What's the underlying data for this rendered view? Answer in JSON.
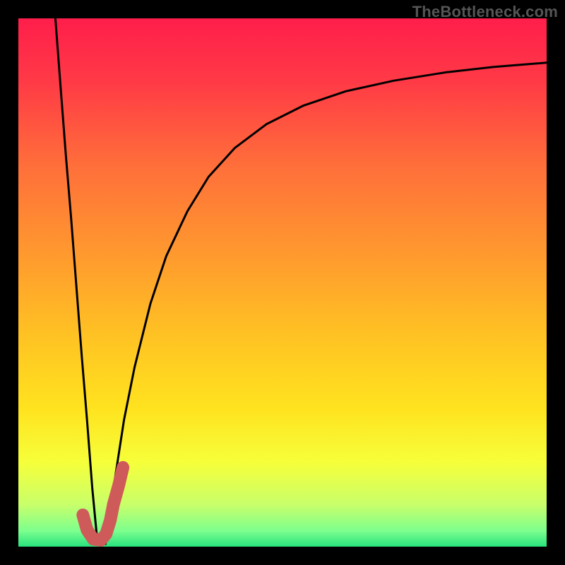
{
  "watermark": "TheBottleneck.com",
  "colors": {
    "page_bg": "#000000",
    "curve": "#000000",
    "marker": "#cf5a5a",
    "gradient_stops": [
      {
        "offset": 0.0,
        "color": "#ff1e4b"
      },
      {
        "offset": 0.12,
        "color": "#ff3a46"
      },
      {
        "offset": 0.28,
        "color": "#ff6f3a"
      },
      {
        "offset": 0.45,
        "color": "#ff9a2e"
      },
      {
        "offset": 0.6,
        "color": "#ffc223"
      },
      {
        "offset": 0.74,
        "color": "#ffe31f"
      },
      {
        "offset": 0.84,
        "color": "#f6ff3a"
      },
      {
        "offset": 0.92,
        "color": "#c9ff6a"
      },
      {
        "offset": 0.97,
        "color": "#7dff8e"
      },
      {
        "offset": 1.0,
        "color": "#28e27e"
      }
    ]
  },
  "chart_data": {
    "type": "line",
    "title": "",
    "xlabel": "",
    "ylabel": "",
    "xlim": [
      0,
      100
    ],
    "ylim": [
      0,
      100
    ],
    "grid": false,
    "series": [
      {
        "name": "left-branch",
        "x": [
          7,
          8,
          9,
          10,
          11,
          12,
          13,
          14,
          15
        ],
        "values": [
          100,
          87,
          74,
          62,
          49,
          36,
          24,
          11,
          0.5
        ]
      },
      {
        "name": "right-branch",
        "x": [
          16.5,
          18,
          20,
          22,
          25,
          28,
          32,
          36,
          41,
          47,
          54,
          62,
          71,
          81,
          90,
          100
        ],
        "values": [
          0.5,
          11,
          24,
          34,
          46,
          55,
          63.5,
          70,
          75.5,
          80,
          83.5,
          86.2,
          88.2,
          89.8,
          90.8,
          91.6
        ]
      }
    ],
    "annotations": [
      {
        "name": "valley-J-marker",
        "kind": "highlight-stroke",
        "color": "#cf5a5a",
        "points_x": [
          12.2,
          13.0,
          14.2,
          15.6,
          16.6,
          17.4,
          18.0,
          19.0,
          19.8
        ],
        "points_y": [
          6.0,
          3.2,
          1.4,
          1.2,
          2.4,
          5.0,
          8.0,
          11.6,
          15.0
        ]
      }
    ]
  }
}
